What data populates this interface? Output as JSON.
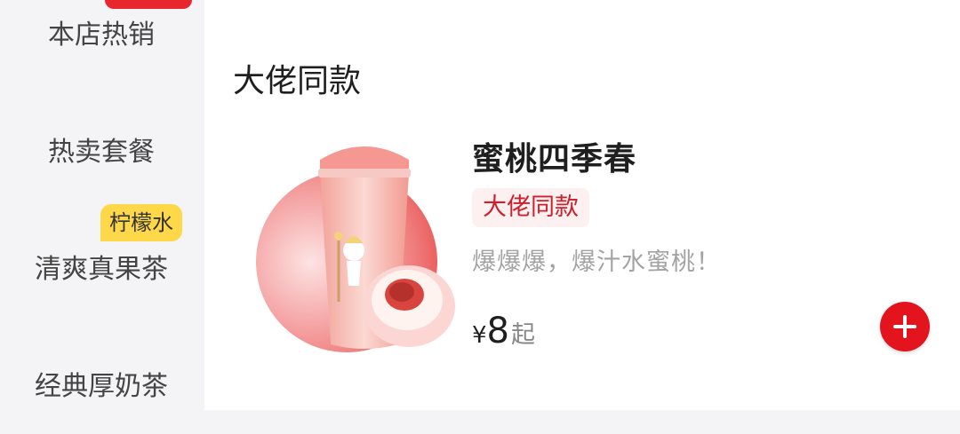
{
  "sidebar": {
    "categories": [
      {
        "label": "本店热销"
      },
      {
        "label": "热卖套餐"
      },
      {
        "label": "清爽真果茶",
        "badge": "柠檬水"
      },
      {
        "label": "经典厚奶茶"
      }
    ]
  },
  "main": {
    "section_title": "大佬同款",
    "product": {
      "name": "蜜桃四季春",
      "tag": "大佬同款",
      "description": "爆爆爆，爆汁水蜜桃！",
      "price_currency": "¥",
      "price_value": "8",
      "price_suffix": "起"
    }
  },
  "colors": {
    "accent": "#e3141e",
    "badge_yellow": "#ffd84a",
    "tag_bg": "#fdf0f0"
  }
}
